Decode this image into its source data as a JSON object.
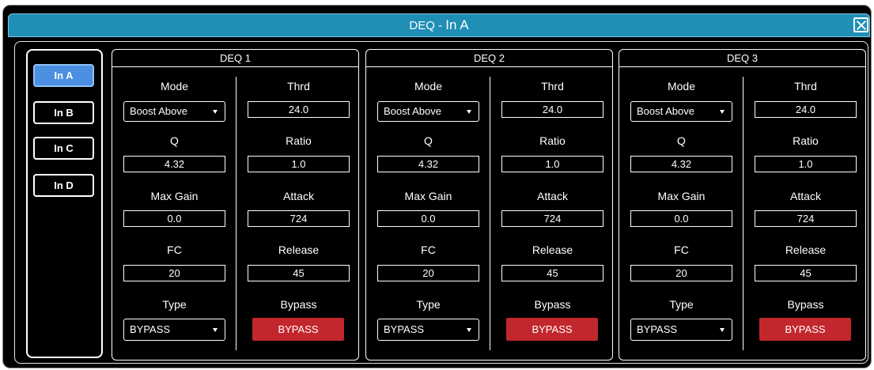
{
  "window": {
    "title": "DEQ - ",
    "channel": "In A"
  },
  "icons": {
    "close": "close-icon",
    "dropdown": "chevron-down-icon"
  },
  "colors": {
    "title_bar": "#1f8fb6",
    "background": "#000000",
    "text": "#ffffff",
    "active_tab": "#4a8fe2",
    "bypass_button": "#c1272d"
  },
  "sidebar": {
    "items": [
      {
        "label": "In A",
        "active": true
      },
      {
        "label": "In B",
        "active": false
      },
      {
        "label": "In C",
        "active": false
      },
      {
        "label": "In D",
        "active": false
      }
    ]
  },
  "deq": [
    {
      "title": "DEQ 1",
      "mode": {
        "label": "Mode",
        "value": "Boost Above"
      },
      "q": {
        "label": "Q",
        "value": "4.32"
      },
      "max_gain": {
        "label": "Max Gain",
        "value": "0.0"
      },
      "fc": {
        "label": "FC",
        "value": "20"
      },
      "type": {
        "label": "Type",
        "value": "BYPASS"
      },
      "thrd": {
        "label": "Thrd",
        "value": "24.0"
      },
      "ratio": {
        "label": "Ratio",
        "value": "1.0"
      },
      "attack": {
        "label": "Attack",
        "value": "724"
      },
      "release": {
        "label": "Release",
        "value": "45"
      },
      "bypass": {
        "label": "Bypass",
        "value": "BYPASS"
      }
    },
    {
      "title": "DEQ 2",
      "mode": {
        "label": "Mode",
        "value": "Boost Above"
      },
      "q": {
        "label": "Q",
        "value": "4.32"
      },
      "max_gain": {
        "label": "Max Gain",
        "value": "0.0"
      },
      "fc": {
        "label": "FC",
        "value": "20"
      },
      "type": {
        "label": "Type",
        "value": "BYPASS"
      },
      "thrd": {
        "label": "Thrd",
        "value": "24.0"
      },
      "ratio": {
        "label": "Ratio",
        "value": "1.0"
      },
      "attack": {
        "label": "Attack",
        "value": "724"
      },
      "release": {
        "label": "Release",
        "value": "45"
      },
      "bypass": {
        "label": "Bypass",
        "value": "BYPASS"
      }
    },
    {
      "title": "DEQ 3",
      "mode": {
        "label": "Mode",
        "value": "Boost Above"
      },
      "q": {
        "label": "Q",
        "value": "4.32"
      },
      "max_gain": {
        "label": "Max Gain",
        "value": "0.0"
      },
      "fc": {
        "label": "FC",
        "value": "20"
      },
      "type": {
        "label": "Type",
        "value": "BYPASS"
      },
      "thrd": {
        "label": "Thrd",
        "value": "24.0"
      },
      "ratio": {
        "label": "Ratio",
        "value": "1.0"
      },
      "attack": {
        "label": "Attack",
        "value": "724"
      },
      "release": {
        "label": "Release",
        "value": "45"
      },
      "bypass": {
        "label": "Bypass",
        "value": "BYPASS"
      }
    }
  ]
}
